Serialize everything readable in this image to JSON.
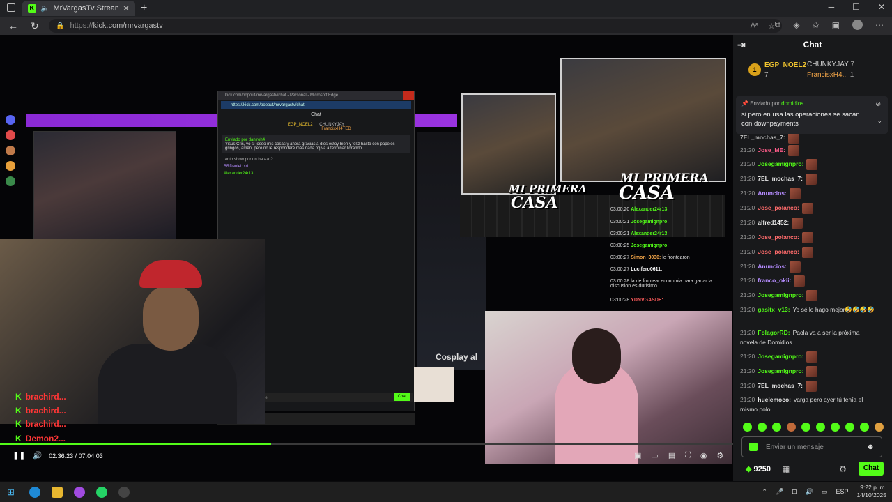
{
  "browser": {
    "tab_title": "MrVargasTv Stream - Watch Live",
    "url": "https://kick.com/mrvargastv",
    "url_prefix": "https://",
    "url_host": "kick.com/mrvargastv"
  },
  "video": {
    "time_current": "02:36:23",
    "time_total": "07:04:03",
    "time_display": "02:36:23 / 07:04:03",
    "progress": 0.37,
    "popup": {
      "window_title": "kick.com/popout/mrvargastv/chat - Personal - Microsoft Edge",
      "url": "https://kick.com/popout/mrvargastv/chat",
      "label": "Chat",
      "gifter1": "EGP_NOEL2",
      "gifter2": "CHUNKYJAY",
      "gifter3": "FrancisxH4TED",
      "pinned_by": "Enviado por daniroh4",
      "pinned_text": "Yisus Cris, yo si joseo mis cosas y ahora gracias a dios estoy bien y feliz hasta con papeles gringos, amén, pero no le responderé más nada pq va a terminar llorando",
      "line1": "tanto show por un batazo?",
      "line2": "BRDaniel: xd",
      "line3": "Alexander24r13:",
      "input_placeholder": "Enviar un mensaje",
      "chat_button": "Chat"
    },
    "overlay_chat": [
      "brachird...",
      "brachird...",
      "brachird...",
      "Demon2..."
    ],
    "caption": "MI PRIMERA CASA",
    "caption_top": "MI PRIMERA",
    "caption_bottom": "CASA",
    "cosplay_label": "Cosplay al",
    "log": [
      {
        "time": "03:00:20",
        "user": "Alexander24r13:",
        "text": ""
      },
      {
        "time": "03:00:21",
        "user": "Josegamignpro:",
        "text": ""
      },
      {
        "time": "03:00:21",
        "user": "Alexander24r13:",
        "text": ""
      },
      {
        "time": "03:00:25",
        "user": "Josegamignpro:",
        "text": ""
      },
      {
        "time": "03:00:27",
        "user": "Simon_3030:",
        "text": "le frontearon"
      },
      {
        "time": "03:00:27",
        "user": "Lucifero0611:",
        "text": ""
      },
      {
        "time": "03:00:28",
        "user": "",
        "text": "la de frontear economia para ganar la discusion es durisimo"
      },
      {
        "time": "03:00:28",
        "user": "YDNVGASDE:",
        "text": ""
      }
    ]
  },
  "chat": {
    "header": "Chat",
    "gifter_rank": "1",
    "gifter1_name": "EGP_NOEL2",
    "gifter1_count": "7",
    "gifter2_name": "CHUNKYJAY",
    "gifter2_count": "7",
    "gifter3_name": "FrancisxH4...",
    "gifter3_count": "1",
    "pinned_by_prefix": "Enviado por",
    "pinned_by_user": "domidios",
    "pinned_text": "si pero en usa las operaciones se sacan con downpayments",
    "messages": [
      {
        "time": "",
        "user": "7EL_mochas_7:",
        "text": "",
        "color": "#b5b5b5"
      },
      {
        "time": "21:20",
        "user": "Jose_ME:",
        "text": "",
        "color": "#ff5c8a"
      },
      {
        "time": "21:20",
        "user": "Josegamignpro:",
        "text": "",
        "color": "#53fc18"
      },
      {
        "time": "21:20",
        "user": "7EL_mochas_7:",
        "text": "",
        "color": "#e6e6e6"
      },
      {
        "time": "21:20",
        "user": "Anuncios:",
        "text": "",
        "color": "#b58cff"
      },
      {
        "time": "21:20",
        "user": "Jose_polanco:",
        "text": "",
        "color": "#ff6b6b"
      },
      {
        "time": "21:20",
        "user": "alfred1452:",
        "text": "",
        "color": "#e6e6e6"
      },
      {
        "time": "21:20",
        "user": "Jose_polanco:",
        "text": "",
        "color": "#ff6b6b"
      },
      {
        "time": "21:20",
        "user": "Jose_polanco:",
        "text": "",
        "color": "#ff6b6b"
      },
      {
        "time": "21:20",
        "user": "Anuncios:",
        "text": "",
        "color": "#b58cff"
      },
      {
        "time": "21:20",
        "user": "franco_okii:",
        "text": "",
        "color": "#b58cff"
      },
      {
        "time": "21:20",
        "user": "Josegamignpro:",
        "text": "",
        "color": "#53fc18"
      },
      {
        "time": "21:20",
        "user": "gasitx_v13:",
        "text": "Yo sé lo hago mejor🤣🤣🤣🤣",
        "color": "#53fc18"
      },
      {
        "time": "21:20",
        "user": "FolagorRD:",
        "text": "Paola va a ser la próxima novela de Domidios",
        "color": "#53fc18"
      },
      {
        "time": "21:20",
        "user": "Josegamignpro:",
        "text": "",
        "color": "#53fc18"
      },
      {
        "time": "21:20",
        "user": "Josegamignpro:",
        "text": "",
        "color": "#53fc18"
      },
      {
        "time": "21:20",
        "user": "7EL_mochas_7:",
        "text": "",
        "color": "#e6e6e6"
      },
      {
        "time": "21:20",
        "user": "huelemoco:",
        "text": "varga pero ayer tú tenía el mismo polo",
        "color": "#e6e6e6"
      }
    ],
    "input_placeholder": "Enviar un mensaje",
    "kicks": "9250",
    "chat_button": "Chat",
    "accent": "#53fc18"
  },
  "taskbar": {
    "time": "9:22 p. m.",
    "date": "14/10/2025",
    "lang": "ESP"
  }
}
